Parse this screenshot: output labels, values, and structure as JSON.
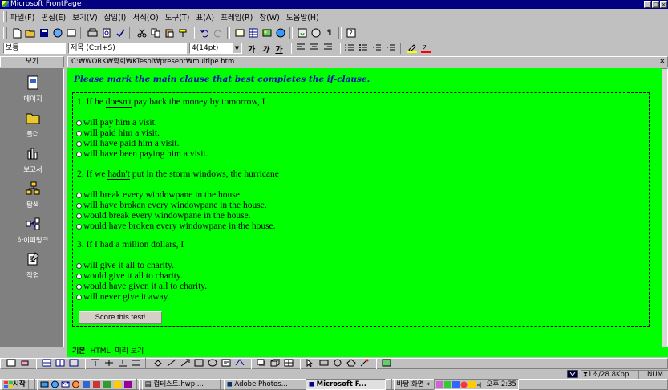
{
  "window": {
    "title": "Microsoft FrontPage",
    "controls": [
      "_",
      "□",
      "×"
    ]
  },
  "menu": [
    "파일(F)",
    "편집(E)",
    "보기(V)",
    "삽입(I)",
    "서식(O)",
    "도구(T)",
    "표(A)",
    "프레임(R)",
    "창(W)",
    "도움말(H)"
  ],
  "toolbar": {
    "style_value": "보통",
    "font_value": "제목 (Ctrl+S)",
    "size_value": "4(14pt)",
    "format_buttons": [
      "가",
      "가",
      "가"
    ]
  },
  "views": {
    "header": "보기",
    "items": [
      "페이지",
      "폴더",
      "보고서",
      "탐색",
      "하이퍼링크",
      "작업"
    ]
  },
  "path": "C:₩WORK₩학회₩KTesol₩present₩multipe.htm",
  "page": {
    "heading": "Please mark the main clause that best completes the if-clause.",
    "questions": [
      {
        "prefix": "1. If he ",
        "underlined": "doesn't",
        "suffix": " pay back the money by tomorrow, I",
        "options": [
          "will pay him a visit.",
          "will paid him a visit.",
          "will have paid him a visit.",
          "will have been paying him a visit."
        ]
      },
      {
        "prefix": "2. If we ",
        "underlined": "hadn't",
        "suffix": " put in the storm windows, the hurricane",
        "options": [
          "will break every windowpane in the house.",
          "will have broken every windowpane in the house.",
          "would break every windowpane in the house.",
          "would have broken every windowpane in the house."
        ]
      },
      {
        "prefix": "3. If I had a million dollars, I",
        "underlined": "",
        "suffix": "",
        "options": [
          "will give it all to charity.",
          "would give it all to charity.",
          "would have given it all to charity.",
          "will never give it away."
        ]
      }
    ],
    "score_button": "Score this test!"
  },
  "tabs": [
    "기본",
    "HTML",
    "미리 보기"
  ],
  "status": {
    "transfer": "1초/28.8Kbp",
    "mode": "NUM"
  },
  "taskbar": {
    "start": "시작",
    "buttons": [
      "컴테스트.hwp ...",
      "Adobe Photos...",
      "Microsoft F..."
    ],
    "desktop": "바탕 화면 »",
    "clock": "오후 2:35"
  }
}
